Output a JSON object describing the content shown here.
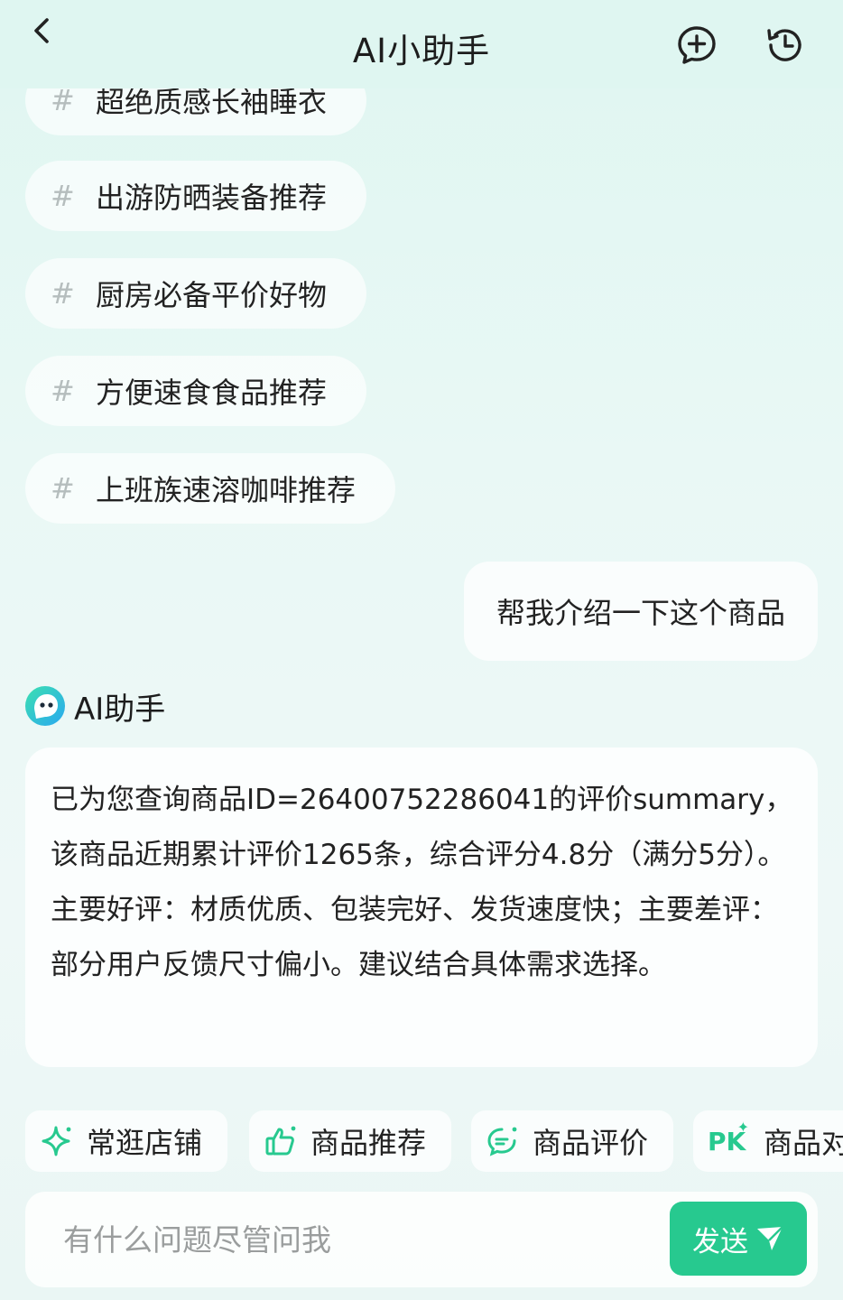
{
  "header": {
    "title": "AI小助手",
    "back_icon": "chevron-left-icon",
    "new_chat_icon": "chat-plus-icon",
    "history_icon": "history-clock-icon"
  },
  "topics": [
    {
      "label": "超绝质感长袖睡衣"
    },
    {
      "label": "出游防晒装备推荐"
    },
    {
      "label": "厨房必备平价好物"
    },
    {
      "label": "方便速食食品推荐"
    },
    {
      "label": "上班族速溶咖啡推荐"
    }
  ],
  "topic_symbol": "#",
  "user_message": "帮我介绍一下这个商品",
  "assistant": {
    "name": "AI助手",
    "message": "已为您查询商品ID=26400752286041的评价summary，该商品近期累计评价1265条，综合评分4.8分（满分5分）。主要好评：材质优质、包装完好、发货速度快；主要差评：部分用户反馈尺寸偏小。建议结合具体需求选择。"
  },
  "quick_actions": [
    {
      "label": "常逛店铺",
      "icon": "sparkle-icon"
    },
    {
      "label": "商品推荐",
      "icon": "thumbs-up-icon"
    },
    {
      "label": "商品评价",
      "icon": "comment-icon"
    },
    {
      "label": "商品对",
      "icon": "pk-icon",
      "icon_text": "PK"
    }
  ],
  "input": {
    "placeholder": "有什么问题尽管问我",
    "value": "",
    "send_label": "发送"
  },
  "colors": {
    "accent": "#27c98f",
    "background": "#e9f8f5",
    "placeholder": "#9a9d9d"
  }
}
